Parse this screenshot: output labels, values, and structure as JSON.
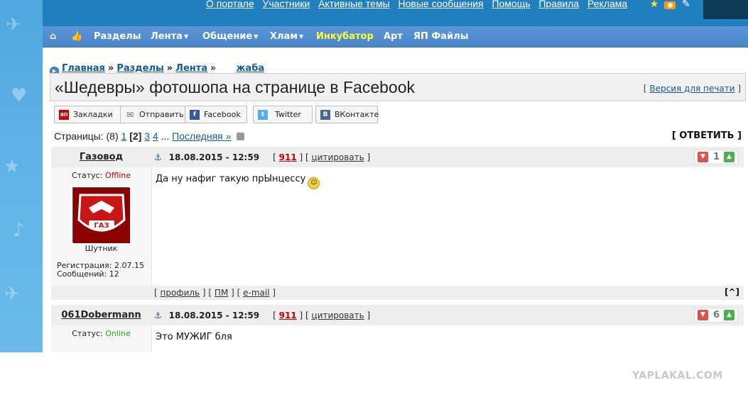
{
  "top_links": [
    "О портале",
    "Участники",
    "Активные темы",
    "Новые сообщения",
    "Помощь",
    "Правила",
    "Реклама"
  ],
  "top_icons": [
    "star-icon",
    "rss-icon",
    "pencil-icon"
  ],
  "nav": {
    "home_icon": "home-icon",
    "like_icon": "thumbs-up-icon",
    "items": [
      {
        "label": "Разделы",
        "dropdown": false
      },
      {
        "label": "Лента",
        "dropdown": true
      },
      {
        "label": "Общение",
        "dropdown": true
      },
      {
        "label": "Хлам",
        "dropdown": true
      },
      {
        "label": "Инкубатор",
        "dropdown": false,
        "highlight": "#ffff33"
      },
      {
        "label": "Арт",
        "dropdown": false
      },
      {
        "label": "ЯП Файлы",
        "dropdown": false
      }
    ]
  },
  "breadcrumb": {
    "items": [
      "Главная",
      "Разделы",
      "Лента",
      "жаба"
    ],
    "separator": "»"
  },
  "topic": {
    "title": "«Шедевры» фотошопа на странице в Facebook",
    "print_label": "Версия для печати"
  },
  "share": [
    {
      "label": "Закладки",
      "icon": "yp-bookmark-icon",
      "color": "#cc0000",
      "glyph": "ЯП"
    },
    {
      "label": "Отправить",
      "icon": "envelope-icon",
      "color": "#888888",
      "glyph": "✉"
    },
    {
      "label": "Facebook",
      "icon": "facebook-icon",
      "color": "#3b5998",
      "glyph": "f"
    },
    {
      "label": "Twitter",
      "icon": "twitter-icon",
      "color": "#55acee",
      "glyph": "t"
    },
    {
      "label": "ВКонтакте",
      "icon": "vk-icon",
      "color": "#45668e",
      "glyph": "B"
    }
  ],
  "pager": {
    "label": "Страницы:",
    "total": "(8)",
    "pages": [
      "1",
      "[2]",
      "3",
      "4"
    ],
    "ellipsis": "...",
    "last": "Последняя »",
    "current": "[2]"
  },
  "reply_label": "[ ОТВЕТИТЬ ]",
  "posts": [
    {
      "author": "Газовод",
      "status_label": "Статус:",
      "status": "Offline",
      "avatar_text": "ГАЗ",
      "rank": "Шутник",
      "reg": "Регистрация: 2.07.15",
      "msgs": "Сообщений: 12",
      "date": "18.08.2015 - 12:59",
      "num": "911",
      "quote": "цитировать",
      "rating": "1",
      "text": "Да ну нафиг такую прЫнцессу",
      "footer": {
        "profile": "профиль",
        "pm": "ПМ",
        "email": "e-mail",
        "top": "[^]"
      }
    },
    {
      "author": "061Dobermann",
      "status_label": "Статус:",
      "status": "Online",
      "date": "18.08.2015 - 12:59",
      "num": "911",
      "quote": "цитировать",
      "rating": "6",
      "text": "Это МУЖИГ бля"
    }
  ],
  "watermark": "YAPLAKAL.COM"
}
